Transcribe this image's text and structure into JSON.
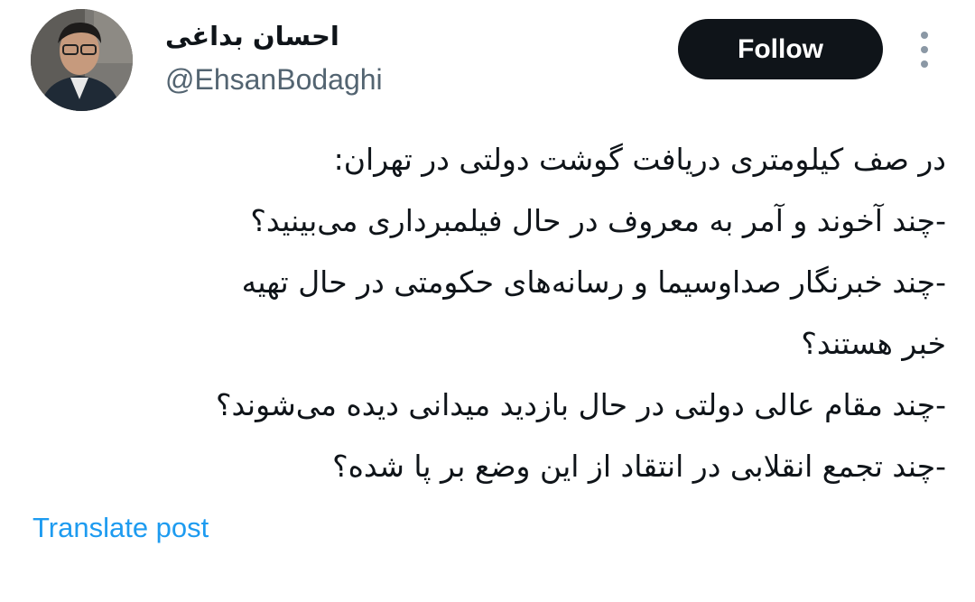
{
  "author": {
    "display_name": "احسان بداغی",
    "handle": "@EhsanBodaghi"
  },
  "actions": {
    "follow_label": "Follow",
    "more_icon": "more-vertical-icon"
  },
  "tweet": {
    "lines": [
      "در صف کیلومتری دریافت گوشت دولتی در تهران:",
      "-چند آخوند و آمر به معروف در حال فیلمبرداری می‌بینید؟",
      "-چند خبرنگار صداوسیما و رسانه‌های حکومتی در حال تهیه",
      "خبر هستند؟",
      "-چند مقام عالی دولتی در حال بازدید میدانی دیده می‌شوند؟",
      "-چند تجمع انقلابی در انتقاد از این وضع بر پا شده؟"
    ]
  },
  "translate_label": "Translate post",
  "colors": {
    "follow_bg": "#0f1419",
    "link": "#1d9bf0",
    "secondary_text": "#536471"
  }
}
